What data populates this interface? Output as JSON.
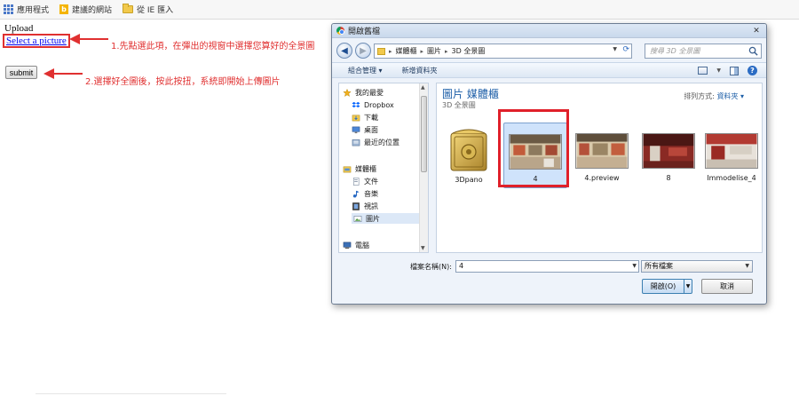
{
  "bookmarks": [
    {
      "label": "應用程式",
      "icon": "apps-grid-icon"
    },
    {
      "label": "建議的網站",
      "icon": "bing-icon"
    },
    {
      "label": "從 IE 匯入",
      "icon": "folder-icon"
    }
  ],
  "page": {
    "heading": "Upload",
    "select_link": "Select a picture",
    "submit_label": "submit"
  },
  "annotations": {
    "step1": "1.先點選此項，在彈出的視窗中選擇您算好的全景圖",
    "step2": "2.選擇好全圖後，按此按扭，系統即開始上傳圖片",
    "color": "#e03030"
  },
  "dialog": {
    "title": "開啟舊檔",
    "breadcrumb": [
      "媒體櫃",
      "圖片",
      "3D 全景圖"
    ],
    "search_placeholder": "搜尋 3D 全景圖",
    "toolbar": {
      "organize": "組合管理 ▾",
      "new_folder": "新增資料夾"
    },
    "nav": {
      "favorites": "我的最愛",
      "dropbox": "Dropbox",
      "downloads": "下載",
      "desktop": "桌面",
      "recent": "最近的位置",
      "libraries": "媒體櫃",
      "documents": "文件",
      "music": "音樂",
      "videos": "視訊",
      "pictures": "圖片",
      "computer": "電腦"
    },
    "library_title": "圖片 媒體櫃",
    "library_subtitle": "3D 全景圖",
    "sort_label": "排列方式:",
    "sort_value": "資料夾 ▾",
    "files": [
      {
        "name": "3Dpano",
        "kind": "folder"
      },
      {
        "name": "4",
        "kind": "image",
        "selected": true
      },
      {
        "name": "4.preview",
        "kind": "image"
      },
      {
        "name": "8",
        "kind": "image"
      },
      {
        "name": "Immodelise_4",
        "kind": "image"
      }
    ],
    "filename_label": "檔案名稱(N):",
    "filename_value": "4",
    "filter_value": "所有檔案",
    "open_label": "開啟(O)",
    "cancel_label": "取消"
  },
  "colors": {
    "highlight_red": "#e0202a",
    "link_blue": "#0000ee",
    "library_blue": "#1e5fa8"
  }
}
